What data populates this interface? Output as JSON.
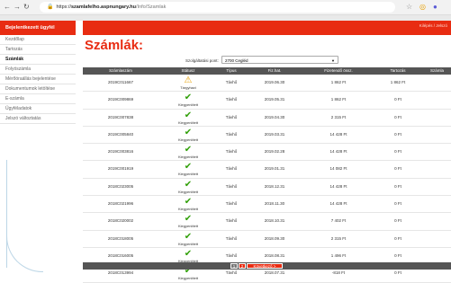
{
  "browser": {
    "url_prefix": "https://",
    "url_host": "szamlafelho.aspnungary.hu",
    "url_path": "/Info/Szamlak"
  },
  "topbar": {
    "link": "Kilépés / Jelszó"
  },
  "sidebar": {
    "header": "Bejelentkezett ügyfél",
    "items": [
      {
        "label": "Kezdőlap"
      },
      {
        "label": "Tartozás"
      },
      {
        "label": "Számlák"
      },
      {
        "label": "Folyószámla"
      },
      {
        "label": "Mérőóraállás bejelentése"
      },
      {
        "label": "Dokumentumok letöltése"
      },
      {
        "label": "E-számla"
      },
      {
        "label": "Ügyféladatok"
      },
      {
        "label": "Jelszó változtatás"
      }
    ]
  },
  "page": {
    "title": "Számlák:"
  },
  "filter": {
    "label": "Szolgáltatási pont:",
    "value": "2700 Cegléd"
  },
  "table": {
    "columns": [
      "Számlaszám",
      "Státusz",
      "Típus",
      "Fiz.hat.",
      "Fizetendő össz.",
      "Tartozás",
      "Számla"
    ],
    "rows": [
      {
        "num": "2019C011667",
        "status": "Tárgyhavi",
        "type": "Távhő",
        "due": "2019.06.30",
        "amount": "1 862 Ft",
        "debt": "1 862 Ft"
      },
      {
        "num": "2019C009869",
        "status": "Kiegyenlített",
        "type": "Távhő",
        "due": "2019.05.31",
        "amount": "1 862 Ft",
        "debt": "0 Ft"
      },
      {
        "num": "2019C007838",
        "status": "Kiegyenlített",
        "type": "Távhő",
        "due": "2019.04.30",
        "amount": "2 315 Ft",
        "debt": "0 Ft"
      },
      {
        "num": "2019C005840",
        "status": "Kiegyenlített",
        "type": "Távhő",
        "due": "2019.03.31",
        "amount": "14 428 Ft",
        "debt": "0 Ft"
      },
      {
        "num": "2019C003816",
        "status": "Kiegyenlített",
        "type": "Távhő",
        "due": "2019.02.28",
        "amount": "14 428 Ft",
        "debt": "0 Ft"
      },
      {
        "num": "2019C001919",
        "status": "Kiegyenlített",
        "type": "Távhő",
        "due": "2019.01.31",
        "amount": "14 082 Ft",
        "debt": "0 Ft"
      },
      {
        "num": "2018C023005",
        "status": "Kiegyenlített",
        "type": "Távhő",
        "due": "2018.12.31",
        "amount": "14 428 Ft",
        "debt": "0 Ft"
      },
      {
        "num": "2018C021996",
        "status": "Kiegyenlített",
        "type": "Távhő",
        "due": "2018.11.30",
        "amount": "14 428 Ft",
        "debt": "0 Ft"
      },
      {
        "num": "2018C020002",
        "status": "Kiegyenlített",
        "type": "Távhő",
        "due": "2018.10.31",
        "amount": "7 402 Ft",
        "debt": "0 Ft"
      },
      {
        "num": "2018C018005",
        "status": "Kiegyenlített",
        "type": "Távhő",
        "due": "2018.09.30",
        "amount": "2 315 Ft",
        "debt": "0 Ft"
      },
      {
        "num": "2018C016005",
        "status": "Kiegyenlített",
        "type": "Távhő",
        "due": "2018.08.31",
        "amount": "1 496 Ft",
        "debt": "0 Ft"
      },
      {
        "num": "2018C013994",
        "status": "Kiegyenlített",
        "type": "Távhő",
        "due": "2018.07.31",
        "amount": "-818 Ft",
        "debt": "0 Ft"
      }
    ]
  },
  "pagination": {
    "page1": "1",
    "page2": "2",
    "next": "Következő >"
  },
  "colors": {
    "accent": "#e82c12",
    "header_bg": "#555555",
    "ok": "#32a00a",
    "warn": "#e8a000"
  },
  "icons": {
    "paid": "check-icon",
    "current": "warning-icon",
    "back": "back-arrow-icon",
    "forward": "forward-arrow-icon",
    "reload": "reload-icon",
    "lock": "lock-icon",
    "star": "star-icon"
  }
}
